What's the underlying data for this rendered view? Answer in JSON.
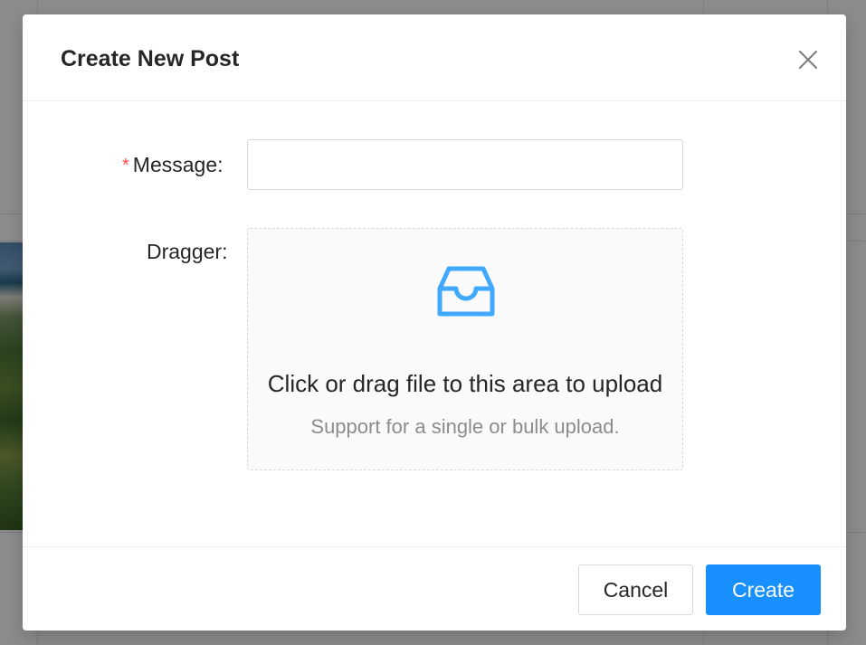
{
  "modal": {
    "title": "Create New Post",
    "close_icon": "close-icon"
  },
  "form": {
    "message": {
      "required_mark": "*",
      "label": "Message",
      "colon": ":",
      "value": "",
      "placeholder": ""
    },
    "dragger": {
      "label": "Dragger",
      "colon": ":",
      "icon": "inbox-icon",
      "text": "Click or drag file to this area to upload",
      "hint": "Support for a single or bulk upload."
    }
  },
  "footer": {
    "cancel_label": "Cancel",
    "create_label": "Create"
  },
  "colors": {
    "primary": "#1890ff",
    "required": "#ff4d4f"
  }
}
